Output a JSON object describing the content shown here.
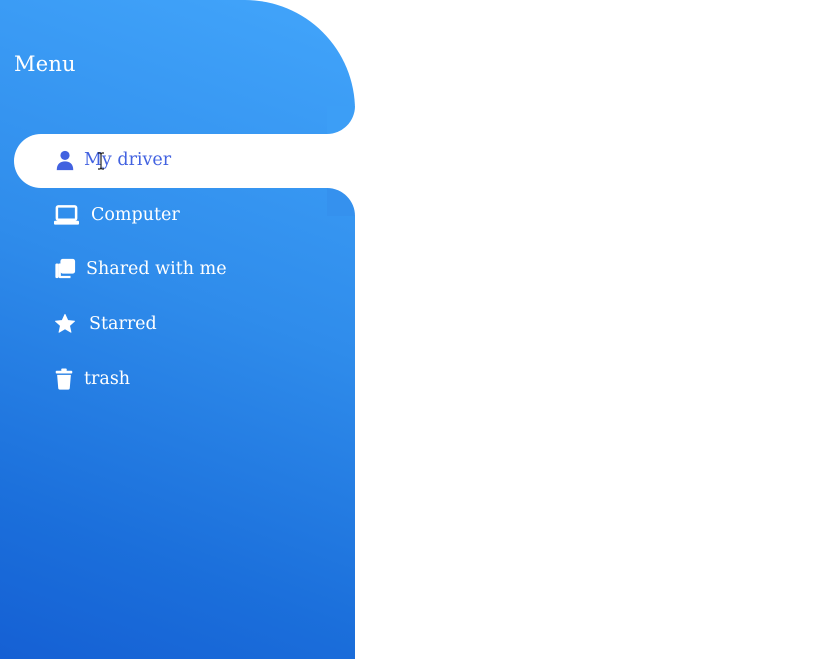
{
  "sidebar": {
    "title": "Menu",
    "items": [
      {
        "label": "My driver",
        "icon": "user-icon",
        "active": true
      },
      {
        "label": "Computer",
        "icon": "laptop-icon",
        "active": false
      },
      {
        "label": "Shared with me",
        "icon": "copy-icon",
        "active": false
      },
      {
        "label": "Starred",
        "icon": "star-icon",
        "active": false
      },
      {
        "label": "trash",
        "icon": "trash-icon",
        "active": false
      }
    ]
  },
  "colors": {
    "sidebar_top": "#42a5fb",
    "sidebar_bottom": "#1560d4",
    "active_text": "#4262e0",
    "active_bg": "#ffffff"
  }
}
